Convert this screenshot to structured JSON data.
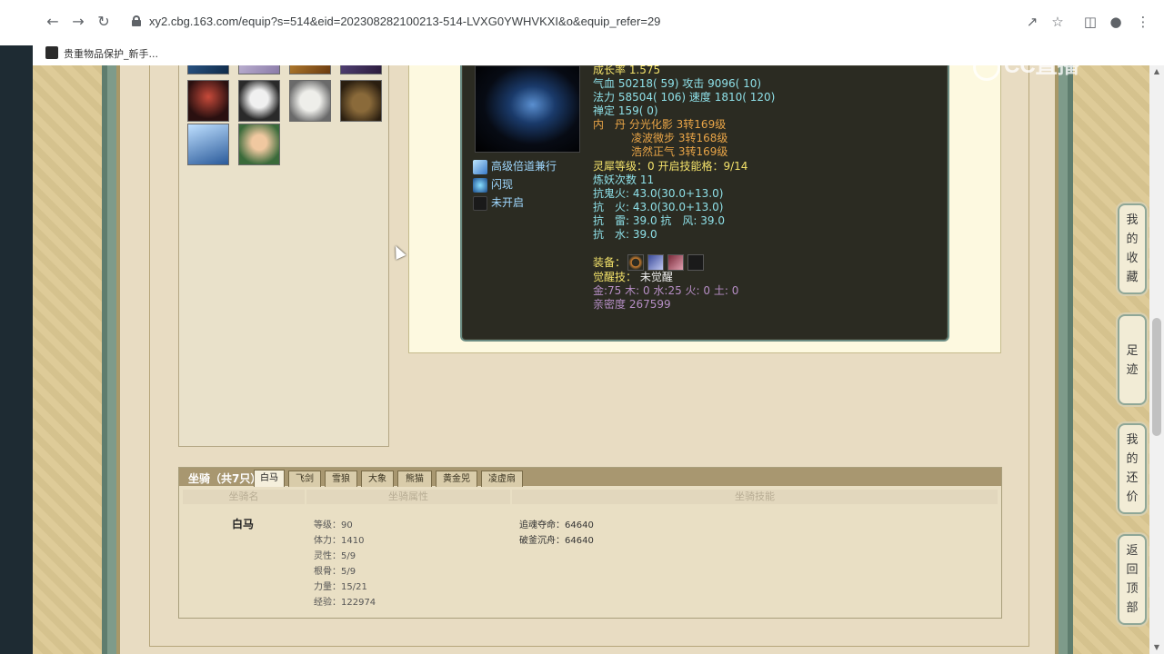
{
  "browser": {
    "url": "xy2.cbg.163.com/equip?s=514&eid=202308282100213-514-LVXG0YWHVKXI&o&equip_refer=29",
    "bookmark_label": "贵重物品保护_新手..."
  },
  "watermark": "CC直播",
  "pet": {
    "skills": [
      "高级倍道兼行",
      "闪现",
      "未开启"
    ],
    "growth": "成长率 1.575",
    "hp": "气血 50218( 59)",
    "attack": "攻击 9096( 10)",
    "mana": "法力 58504( 106)",
    "speed": "速度 1810( 120)",
    "calm": "禅定 159( 0)",
    "inner_label": "内　丹",
    "inner_1": "分光化影 3转169级",
    "inner_2": "凌波微步 3转168级",
    "inner_3": "浩然正气 3转169级",
    "spirit": "灵犀等级：0 开启技能格：9/14",
    "refine": "炼妖次数 11",
    "res_ghost_fire": "抗鬼火: 43.0(30.0+13.0)",
    "res_fire": "抗　火: 43.0(30.0+13.0)",
    "res_thunder_wind": "抗　雷: 39.0 抗　风: 39.0",
    "res_water": "抗　水: 39.0",
    "equip_label": "装备：",
    "awaken_label": "觉醒技：",
    "awaken_value": "未觉醒",
    "elements": "金:75 木: 0 水:25 火: 0 土: 0",
    "intimacy": "亲密度 267599"
  },
  "mount": {
    "title": "坐骑（共7只）",
    "tabs": [
      "白马",
      "飞剑",
      "雪狼",
      "大象",
      "熊猫",
      "黄金兕",
      "凌虚扇"
    ],
    "col_name": "坐骑名",
    "col_attr": "坐骑属性",
    "col_skill": "坐骑技能",
    "name": "白马",
    "attrs": [
      "等级：90",
      "体力：1410",
      "灵性：5/9",
      "根骨：5/9",
      "力量：15/21",
      "经验：122974"
    ],
    "skills": [
      "追魂夺命：64640",
      "破釜沉舟：64640"
    ]
  },
  "float_nav": {
    "favorites": [
      "我",
      "的",
      "收",
      "藏"
    ],
    "footprint": [
      "足",
      "迹"
    ],
    "bargain": [
      "我",
      "的",
      "还",
      "价"
    ],
    "top": [
      "返",
      "回",
      "顶",
      "部"
    ]
  },
  "colors": {
    "page_bg": "#dcc892",
    "panel_dark": "#2b2b22",
    "text_yellow": "#f3e26a",
    "text_cyan": "#8ee0e8",
    "text_orange": "#e8a447"
  }
}
